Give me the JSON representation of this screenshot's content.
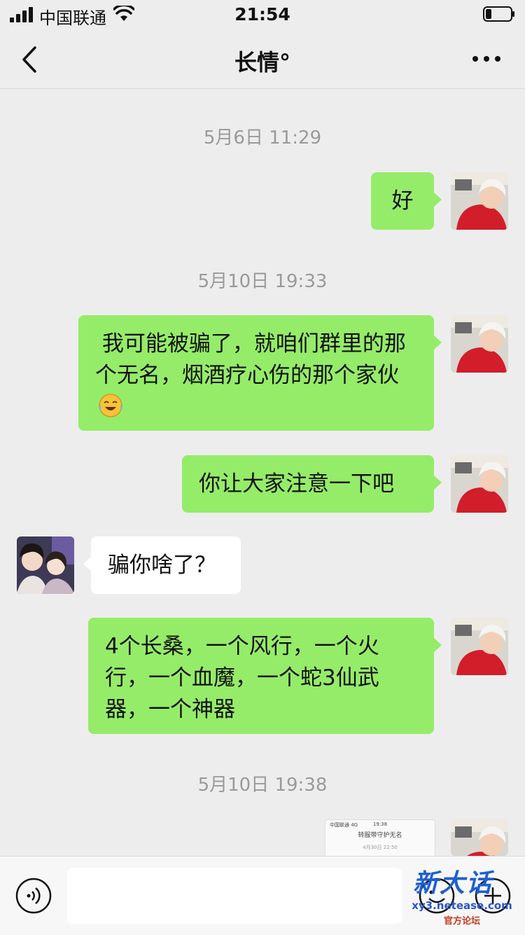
{
  "status_bar": {
    "carrier": "中国联通",
    "time": "21:54"
  },
  "nav": {
    "title": "长情°"
  },
  "messages": [
    {
      "type": "timestamp",
      "text": "5月6日 11:29"
    },
    {
      "type": "sent",
      "text": "好"
    },
    {
      "type": "timestamp",
      "text": "5月10日 19:33"
    },
    {
      "type": "sent",
      "text": " 我可能被骗了，就咱们群里的那个无名，烟酒疗心伤的那个家伙",
      "emoji": "tears-of-joy-emoji"
    },
    {
      "type": "sent",
      "text": "你让大家注意一下吧"
    },
    {
      "type": "received",
      "text": "骗你啥了？"
    },
    {
      "type": "sent",
      "text": "4个长桑，一个风行，一个火行，一个血魔，一个蛇3仙武器，一个神器"
    },
    {
      "type": "timestamp",
      "text": "5月10日 19:38"
    },
    {
      "type": "sent",
      "image": {
        "status": "中国联通 4G",
        "time": "19:38",
        "title": "转服带守护无名",
        "timestamp": "4月30日 22:50"
      }
    }
  ],
  "watermark": {
    "logo_text": "新大话",
    "url": "xy3.netease.com",
    "subtitle": "官方论坛"
  },
  "icons": {
    "back": "chevron-left-icon",
    "more": "ellipsis-icon",
    "voice": "voice-icon",
    "emoji": "smiley-icon",
    "plus": "plus-icon"
  },
  "colors": {
    "background": "#ededed",
    "sent_bubble": "#95ec69",
    "received_bubble": "#ffffff",
    "timestamp": "#9a9a9a"
  }
}
